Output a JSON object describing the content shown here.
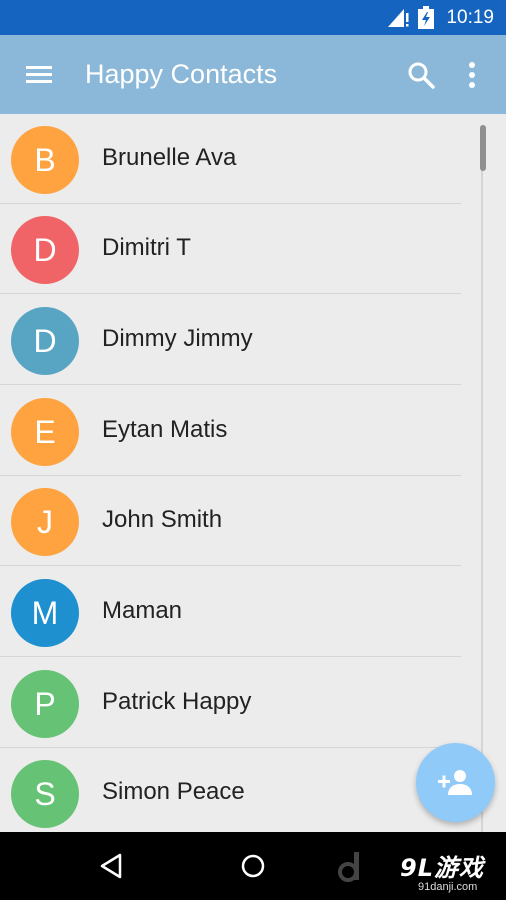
{
  "status_bar": {
    "time": "10:19",
    "signal_icon": "signal-warning-icon",
    "battery_icon": "battery-charging-icon"
  },
  "app_bar": {
    "title": "Happy Contacts",
    "menu_icon": "menu-icon",
    "search_icon": "search-icon",
    "more_icon": "more-vert-icon",
    "color": "#8bb8d8"
  },
  "contacts": [
    {
      "initial": "B",
      "name": "Brunelle Ava",
      "color": "#ffa340"
    },
    {
      "initial": "D",
      "name": "Dimitri T",
      "color": "#f06467"
    },
    {
      "initial": "D",
      "name": "Dimmy Jimmy",
      "color": "#57a5c3"
    },
    {
      "initial": "E",
      "name": "Eytan Matis",
      "color": "#ffa340"
    },
    {
      "initial": "J",
      "name": "John Smith",
      "color": "#ffa340"
    },
    {
      "initial": "M",
      "name": "Maman",
      "color": "#1e8fcf"
    },
    {
      "initial": "P",
      "name": "Patrick Happy",
      "color": "#66c274"
    },
    {
      "initial": "S",
      "name": "Simon Peace",
      "color": "#66c274"
    }
  ],
  "fab": {
    "icon": "add-person-icon",
    "color": "#90caf9"
  },
  "nav_bar": {
    "back_icon": "back-icon",
    "home_icon": "home-icon"
  },
  "watermark": {
    "brand": "9L游戏",
    "url": "91danji.com"
  }
}
